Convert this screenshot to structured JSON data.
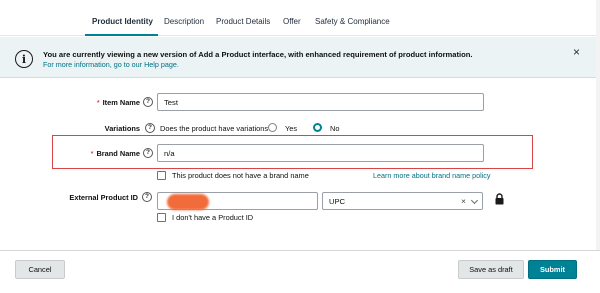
{
  "tabs": [
    {
      "label": "Product Identity",
      "active": true
    },
    {
      "label": "Description"
    },
    {
      "label": "Product Details"
    },
    {
      "label": "Offer"
    },
    {
      "label": "Safety & Compliance"
    }
  ],
  "banner": {
    "title": "You are currently viewing a new version of Add a Product interface, with enhanced requirement of product information.",
    "subtitle": "For more information, go to our Help page.",
    "close": "×"
  },
  "form": {
    "item_name": {
      "required_mark": "*",
      "label": "Item Name",
      "value": "Test"
    },
    "variations": {
      "label": "Variations",
      "question": "Does the product have variations?",
      "options": [
        "Yes",
        "No"
      ],
      "selected": "No"
    },
    "brand_name": {
      "required_mark": "*",
      "label": "Brand Name",
      "value": "n/a",
      "no_brand_label": "This product does not have a brand name",
      "learn_more": "Learn more about brand name policy"
    },
    "external_id": {
      "label": "External Product ID",
      "type_value": "UPC",
      "clear": "×",
      "no_id_label": "I don't have a Product ID"
    },
    "help_glyph": "?"
  },
  "footer": {
    "cancel": "Cancel",
    "save_draft": "Save as draft",
    "submit": "Submit"
  },
  "colors": {
    "accent": "#008296",
    "link": "#007185",
    "required": "#c40000",
    "highlight": "#d94444",
    "banner_bg": "#ebf3f4"
  }
}
